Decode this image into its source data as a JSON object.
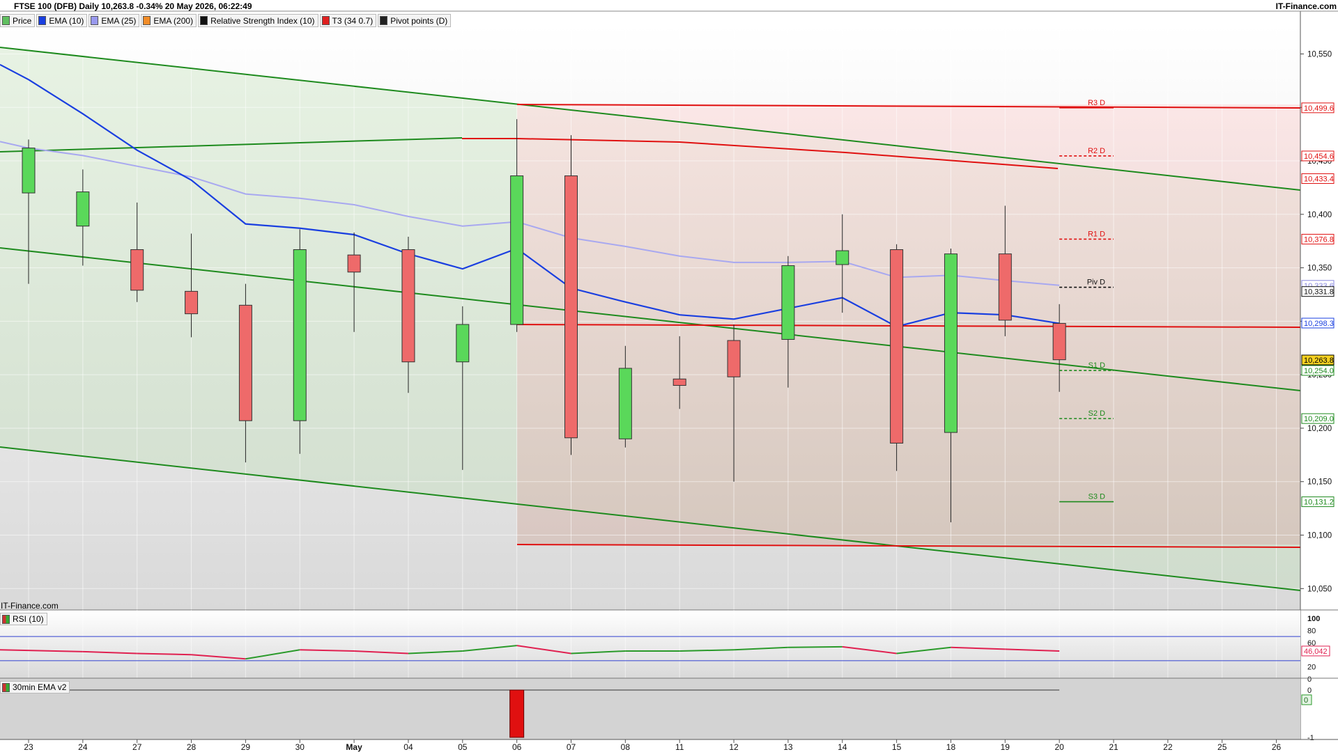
{
  "header": {
    "title": "FTSE 100 (DFB) Daily 10,263.8 -0.34% 20 May 2026, 06:22:49",
    "brand": "IT-Finance.com"
  },
  "legend": [
    {
      "label": "Price",
      "color": "#5fbf5f"
    },
    {
      "label": "EMA (10)",
      "color": "#1a3fe0"
    },
    {
      "label": "EMA (25)",
      "color": "#9999ee"
    },
    {
      "label": "EMA (200)",
      "color": "#f28c28"
    },
    {
      "label": "Relative Strength Index (10)",
      "color": "#111111"
    },
    {
      "label": "T3 (34 0.7)",
      "color": "#e02020"
    },
    {
      "label": "Pivot points (D)",
      "color": "#222222"
    }
  ],
  "watermark": "IT-Finance.com",
  "rsi_tag": "RSI (10)",
  "ema30_tag": "30min EMA v2",
  "colors": {
    "up": "#5ad85a",
    "down": "#ee6a6a",
    "ema10": "#1a3fe0",
    "ema25": "#a8a8f0",
    "channel": "#1d8a1d",
    "t3": "#e01010",
    "pivot": "#222222"
  },
  "chart_data": {
    "type": "candlestick",
    "title": "FTSE 100 (DFB) Daily 10,263.8 -0.34% 20 May 2026, 06:22:49",
    "x_labels": [
      "23",
      "24",
      "27",
      "28",
      "29",
      "30",
      "May",
      "04",
      "05",
      "06",
      "07",
      "08",
      "11",
      "12",
      "13",
      "14",
      "15",
      "18",
      "19",
      "20",
      "21",
      "22",
      "25",
      "26"
    ],
    "y_ticks": [
      10050,
      10100,
      10150,
      10200,
      10250,
      10300,
      10350,
      10400,
      10450,
      10500,
      10550
    ],
    "y_tick_labels": [
      "10,050",
      "10,100",
      "10,150",
      "10,200",
      "10,250",
      "10,300",
      "10,350",
      "10,400",
      "10,450",
      "10,500",
      "10,550"
    ],
    "ylim": [
      10030,
      10577
    ],
    "candles": [
      {
        "d": "23",
        "o": 10420,
        "h": 10470,
        "l": 10335,
        "c": 10462
      },
      {
        "d": "24",
        "o": 10389,
        "h": 10442,
        "l": 10352,
        "c": 10421
      },
      {
        "d": "27",
        "o": 10367,
        "h": 10411,
        "l": 10318,
        "c": 10329
      },
      {
        "d": "28",
        "o": 10328,
        "h": 10382,
        "l": 10285,
        "c": 10307
      },
      {
        "d": "29",
        "o": 10315,
        "h": 10335,
        "l": 10168,
        "c": 10207
      },
      {
        "d": "30",
        "o": 10207,
        "h": 10386,
        "l": 10176,
        "c": 10367
      },
      {
        "d": "May",
        "o": 10362,
        "h": 10383,
        "l": 10290,
        "c": 10346
      },
      {
        "d": "04",
        "o": 10367,
        "h": 10379,
        "l": 10233,
        "c": 10262
      },
      {
        "d": "05",
        "o": 10262,
        "h": 10314,
        "l": 10161,
        "c": 10297
      },
      {
        "d": "06",
        "o": 10297,
        "h": 10489,
        "l": 10290,
        "c": 10436
      },
      {
        "d": "07",
        "o": 10436,
        "h": 10474,
        "l": 10175,
        "c": 10191
      },
      {
        "d": "08",
        "o": 10190,
        "h": 10277,
        "l": 10182,
        "c": 10256
      },
      {
        "d": "11",
        "o": 10246,
        "h": 10286,
        "l": 10218,
        "c": 10240
      },
      {
        "d": "12",
        "o": 10282,
        "h": 10297,
        "l": 10150,
        "c": 10248
      },
      {
        "d": "13",
        "o": 10283,
        "h": 10361,
        "l": 10238,
        "c": 10352
      },
      {
        "d": "14",
        "o": 10353,
        "h": 10400,
        "l": 10308,
        "c": 10366
      },
      {
        "d": "15",
        "o": 10367,
        "h": 10372,
        "l": 10160,
        "c": 10186
      },
      {
        "d": "18",
        "o": 10196,
        "h": 10368,
        "l": 10112,
        "c": 10363
      },
      {
        "d": "19",
        "o": 10363,
        "h": 10408,
        "l": 10286,
        "c": 10301
      },
      {
        "d": "20",
        "o": 10298,
        "h": 10316,
        "l": 10234,
        "c": 10264
      }
    ],
    "ema10": [
      {
        "d": "23",
        "v": 10526
      },
      {
        "d": "24",
        "v": 10494
      },
      {
        "d": "27",
        "v": 10460
      },
      {
        "d": "28",
        "v": 10432
      },
      {
        "d": "29",
        "v": 10391
      },
      {
        "d": "30",
        "v": 10387
      },
      {
        "d": "May",
        "v": 10381
      },
      {
        "d": "04",
        "v": 10363
      },
      {
        "d": "05",
        "v": 10349
      },
      {
        "d": "06",
        "v": 10368
      },
      {
        "d": "07",
        "v": 10331
      },
      {
        "d": "08",
        "v": 10318
      },
      {
        "d": "11",
        "v": 10306
      },
      {
        "d": "12",
        "v": 10302
      },
      {
        "d": "13",
        "v": 10312
      },
      {
        "d": "14",
        "v": 10322
      },
      {
        "d": "15",
        "v": 10295
      },
      {
        "d": "18",
        "v": 10308
      },
      {
        "d": "19",
        "v": 10306
      },
      {
        "d": "20",
        "v": 10298
      }
    ],
    "ema25": [
      {
        "d": "23",
        "v": 10462
      },
      {
        "d": "24",
        "v": 10455
      },
      {
        "d": "27",
        "v": 10445
      },
      {
        "d": "28",
        "v": 10435
      },
      {
        "d": "29",
        "v": 10419
      },
      {
        "d": "30",
        "v": 10415
      },
      {
        "d": "May",
        "v": 10409
      },
      {
        "d": "04",
        "v": 10398
      },
      {
        "d": "05",
        "v": 10389
      },
      {
        "d": "06",
        "v": 10393
      },
      {
        "d": "07",
        "v": 10378
      },
      {
        "d": "08",
        "v": 10370
      },
      {
        "d": "11",
        "v": 10361
      },
      {
        "d": "12",
        "v": 10355
      },
      {
        "d": "13",
        "v": 10355
      },
      {
        "d": "14",
        "v": 10356
      },
      {
        "d": "15",
        "v": 10341
      },
      {
        "d": "18",
        "v": 10343
      },
      {
        "d": "19",
        "v": 10338
      },
      {
        "d": "20",
        "v": 10333.6
      }
    ],
    "pivots": [
      {
        "label": "R3 D",
        "value": 10499.6,
        "tag": "10,499.6",
        "color": "#e01010",
        "dashed": false
      },
      {
        "label": "R2 D",
        "value": 10454.6,
        "tag": "10,454.6",
        "color": "#e01010",
        "dashed": true
      },
      {
        "label": "R1 D",
        "value": 10376.8,
        "tag": "10,376.8",
        "color": "#e01010",
        "dashed": true
      },
      {
        "label": "Piv D",
        "value": 10331.8,
        "tag": "10,331.8",
        "color": "#111111",
        "dashed": true
      },
      {
        "label": "S1 D",
        "value": 10254.0,
        "tag": "10,254.0",
        "color": "#1d8a1d",
        "dashed": true
      },
      {
        "label": "S2 D",
        "value": 10209.0,
        "tag": "10,209.0",
        "color": "#1d8a1d",
        "dashed": true
      },
      {
        "label": "S3 D",
        "value": 10131.2,
        "tag": "10,131.2",
        "color": "#1d8a1d",
        "dashed": false
      }
    ],
    "price_tags": [
      {
        "value": 10433.4,
        "tag": "10,433.4",
        "color": "#e01010",
        "bg": "#ffffff"
      },
      {
        "value": 10333.6,
        "tag": "10,333.6",
        "color": "#8a8ae0",
        "bg": "#ffffff"
      },
      {
        "value": 10298.3,
        "tag": "10,298.3",
        "color": "#1a3fe0",
        "bg": "#ffffff"
      },
      {
        "value": 10263.8,
        "tag": "10,263.8",
        "color": "#000000",
        "bg": "#f5d020"
      }
    ],
    "rsi": {
      "values": [
        {
          "d": "23",
          "v": 47
        },
        {
          "d": "24",
          "v": 45
        },
        {
          "d": "27",
          "v": 42
        },
        {
          "d": "28",
          "v": 40
        },
        {
          "d": "29",
          "v": 33
        },
        {
          "d": "30",
          "v": 48
        },
        {
          "d": "May",
          "v": 46
        },
        {
          "d": "04",
          "v": 42
        },
        {
          "d": "05",
          "v": 46
        },
        {
          "d": "06",
          "v": 55
        },
        {
          "d": "07",
          "v": 42
        },
        {
          "d": "08",
          "v": 46
        },
        {
          "d": "11",
          "v": 46
        },
        {
          "d": "12",
          "v": 48
        },
        {
          "d": "13",
          "v": 52
        },
        {
          "d": "14",
          "v": 53
        },
        {
          "d": "15",
          "v": 42
        },
        {
          "d": "18",
          "v": 52
        },
        {
          "d": "19",
          "v": 49
        },
        {
          "d": "20",
          "v": 46.042
        }
      ],
      "levels": [
        70,
        30
      ],
      "ticks": [
        "100",
        "80",
        "60",
        "20",
        "0"
      ],
      "tick_values": [
        100,
        80,
        60,
        20,
        0
      ],
      "value_tag": "46,042"
    },
    "ema30": {
      "bars": [
        {
          "d": "06",
          "v": -1
        }
      ],
      "ticks": [
        "0",
        "-1"
      ],
      "tick_values": [
        0,
        -1
      ],
      "value_tag": "0"
    }
  }
}
